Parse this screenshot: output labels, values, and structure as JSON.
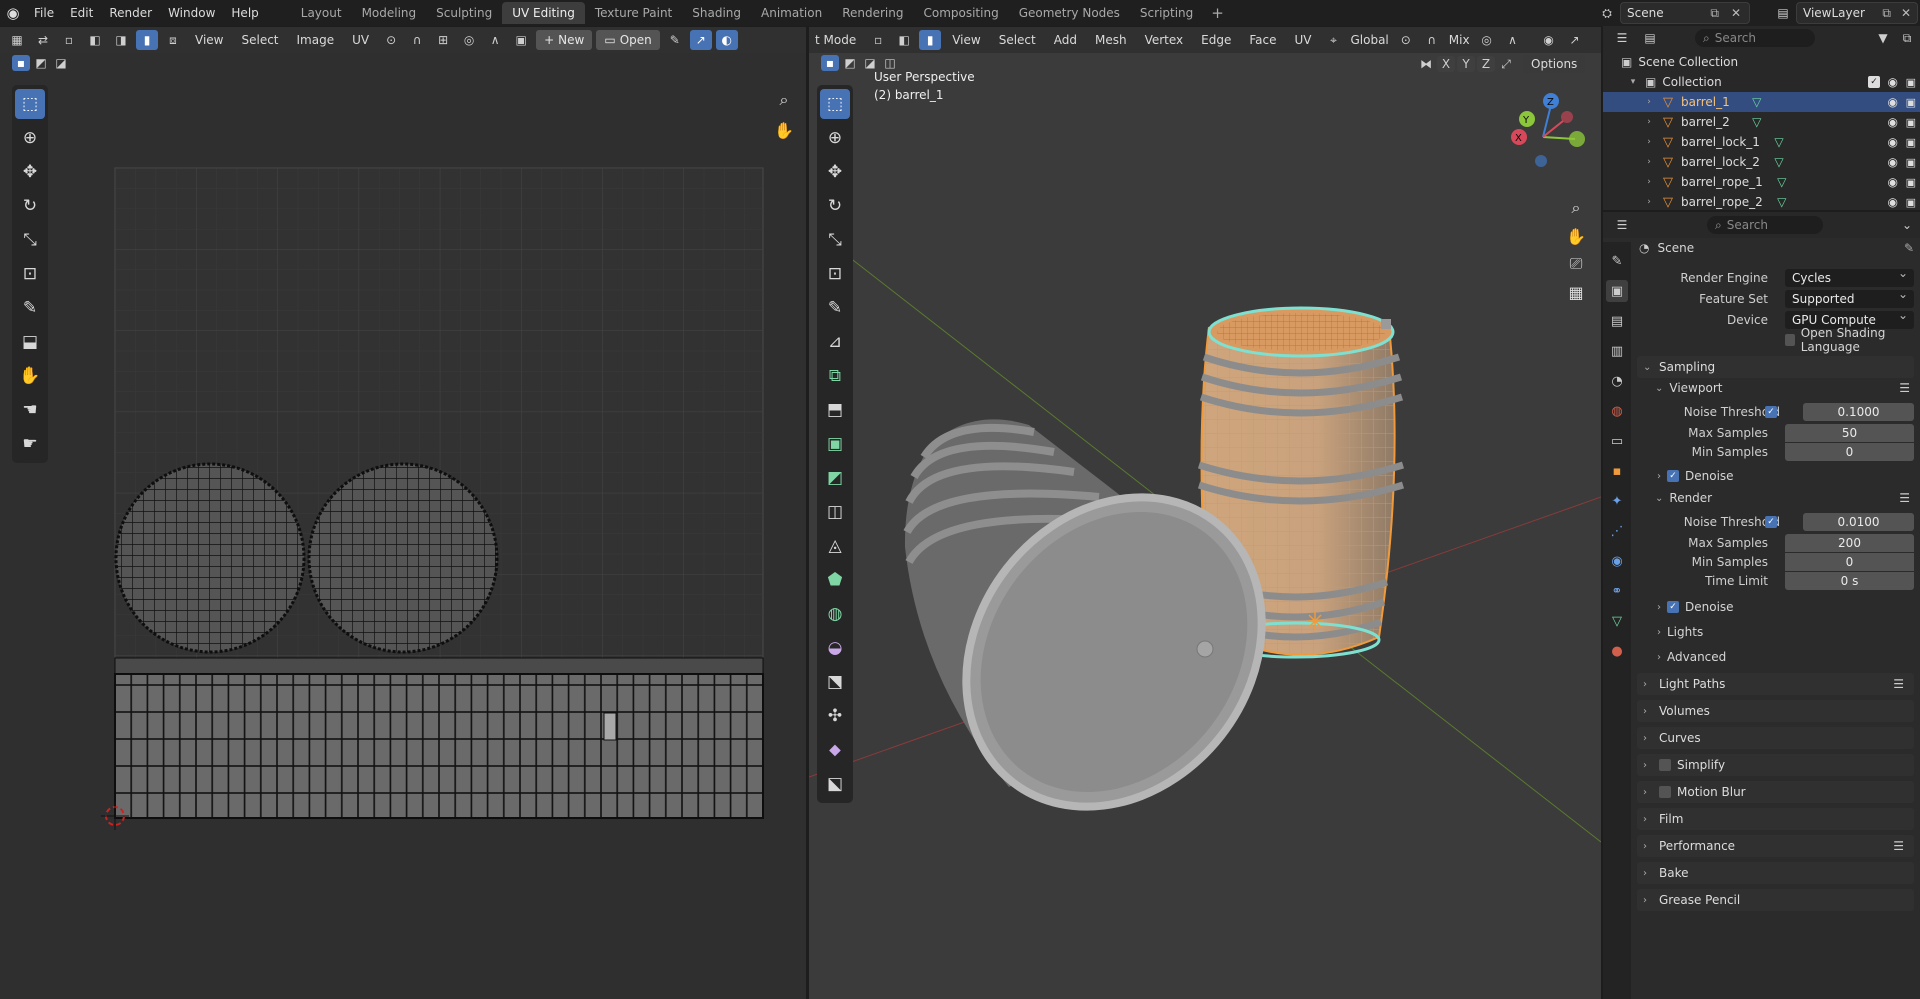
{
  "topbar": {
    "menus": [
      "File",
      "Edit",
      "Render",
      "Window",
      "Help"
    ],
    "workspaces": [
      "Layout",
      "Modeling",
      "Sculpting",
      "UV Editing",
      "Texture Paint",
      "Shading",
      "Animation",
      "Rendering",
      "Compositing",
      "Geometry Nodes",
      "Scripting"
    ],
    "active_workspace": "UV Editing",
    "scene": "Scene",
    "view_layer": "ViewLayer"
  },
  "uv_editor": {
    "menus": [
      "View",
      "Select",
      "Image",
      "UV"
    ],
    "new_label": "New",
    "open_label": "Open"
  },
  "viewport": {
    "mode": "t Mode",
    "menus": [
      "View",
      "Select",
      "Add",
      "Mesh",
      "Vertex",
      "Edge",
      "Face",
      "UV"
    ],
    "transform_orientation": "Global",
    "shading": "Mix",
    "options_label": "Options",
    "axis_labels": [
      "X",
      "Y",
      "Z"
    ],
    "perspective_label": "User Perspective",
    "object_label": "(2) barrel_1"
  },
  "outliner": {
    "search_placeholder": "Search",
    "scene_collection": "Scene Collection",
    "collection": "Collection",
    "items": [
      {
        "name": "barrel_1",
        "selected": true
      },
      {
        "name": "barrel_2",
        "selected": false
      },
      {
        "name": "barrel_lock_1",
        "selected": false
      },
      {
        "name": "barrel_lock_2",
        "selected": false
      },
      {
        "name": "barrel_rope_1",
        "selected": false
      },
      {
        "name": "barrel_rope_2",
        "selected": false
      }
    ]
  },
  "properties": {
    "search_placeholder": "Search",
    "context": "Scene",
    "render_engine_label": "Render Engine",
    "render_engine": "Cycles",
    "feature_set_label": "Feature Set",
    "feature_set": "Supported",
    "device_label": "Device",
    "device": "GPU Compute",
    "osl_label": "Open Shading Language",
    "sampling": "Sampling",
    "viewport": "Viewport",
    "noise_threshold_label": "Noise Threshold",
    "viewport_noise": "0.1000",
    "max_samples_label": "Max Samples",
    "viewport_max": "50",
    "min_samples_label": "Min Samples",
    "viewport_min": "0",
    "denoise": "Denoise",
    "render": "Render",
    "render_noise": "0.0100",
    "render_max": "200",
    "render_min": "0",
    "time_limit_label": "Time Limit",
    "time_limit": "0 s",
    "lights": "Lights",
    "advanced": "Advanced",
    "panels": [
      "Light Paths",
      "Volumes",
      "Curves",
      "Simplify",
      "Motion Blur",
      "Film",
      "Performance",
      "Bake",
      "Grease Pencil"
    ]
  },
  "colors": {
    "accent": "#4772b3",
    "selection_orange": "#f09a3b",
    "mesh_green": "#6cd4a0"
  }
}
